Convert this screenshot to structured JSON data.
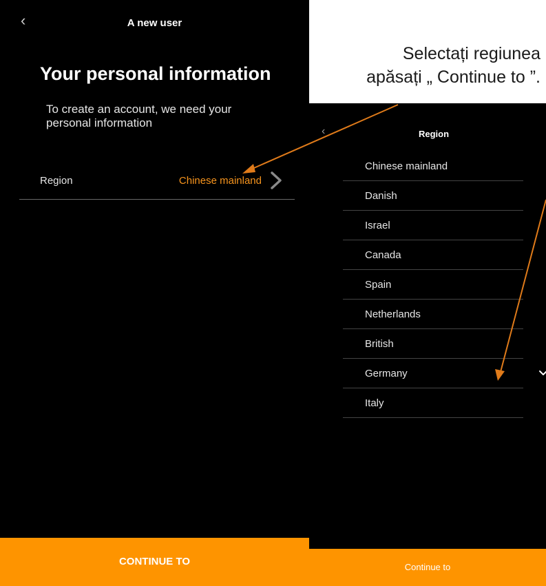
{
  "screen1": {
    "back_icon": "chevron-left",
    "title": "A new user",
    "heading": "Your personal information",
    "description": "To create an account, we need your personal information",
    "region_label": "Region",
    "region_value": "Chinese mainland",
    "continue_label": "CONTINUE TO"
  },
  "callout": {
    "line1": "Selectați regiunea",
    "line2": "apăsați „ Continue to ”."
  },
  "screen2": {
    "back_icon": "chevron-left",
    "title": "Region",
    "items": [
      {
        "label": "Chinese mainland"
      },
      {
        "label": "Danish"
      },
      {
        "label": "Israel"
      },
      {
        "label": "Canada"
      },
      {
        "label": "Spain"
      },
      {
        "label": "Netherlands"
      },
      {
        "label": "British"
      },
      {
        "label": "Germany",
        "selected": true
      },
      {
        "label": "Italy"
      }
    ],
    "continue_label": "Continue to"
  },
  "colors": {
    "accent": "#fe9400",
    "arrow": "#e07b1a",
    "background": "#000000"
  }
}
